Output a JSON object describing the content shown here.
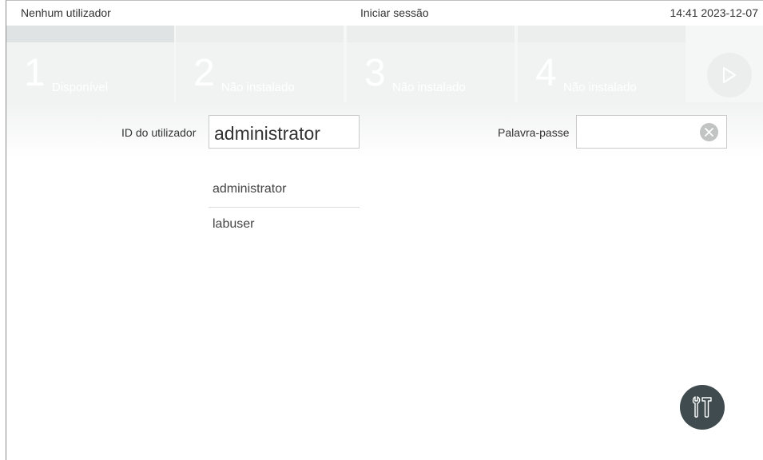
{
  "status_bar": {
    "user": "Nenhum utilizador",
    "title": "Iniciar sessão",
    "clock": "14:41 2023-12-07"
  },
  "modules": [
    {
      "number": "1",
      "status": "Disponível"
    },
    {
      "number": "2",
      "status": "Não instalado"
    },
    {
      "number": "3",
      "status": "Não instalado"
    },
    {
      "number": "4",
      "status": "Não instalado"
    }
  ],
  "login": {
    "user_label": "ID do utilizador",
    "user_value": "administrator",
    "password_label": "Palavra-passe",
    "password_value": ""
  },
  "user_list": [
    "administrator",
    "labuser"
  ],
  "icons": {
    "play": "play-icon",
    "clear": "close-icon",
    "tools": "tools-icon"
  },
  "colors": {
    "tools_button": "#3f4b4e",
    "clear_button": "#c2c4c4"
  }
}
